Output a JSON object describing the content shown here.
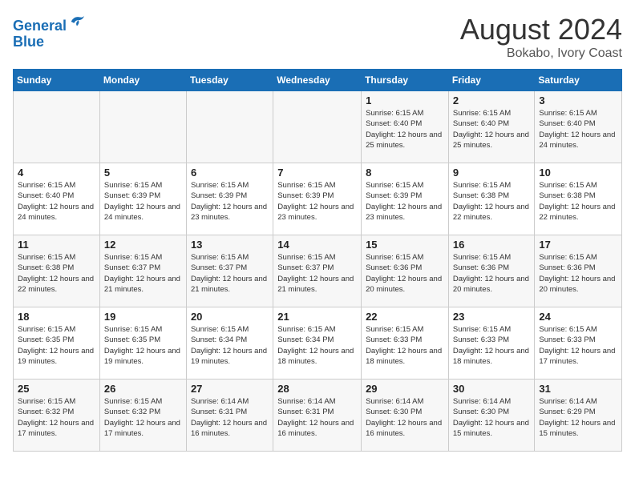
{
  "header": {
    "logo_line1": "General",
    "logo_line2": "Blue",
    "month_year": "August 2024",
    "location": "Bokabo, Ivory Coast"
  },
  "weekdays": [
    "Sunday",
    "Monday",
    "Tuesday",
    "Wednesday",
    "Thursday",
    "Friday",
    "Saturday"
  ],
  "weeks": [
    [
      {
        "day": "",
        "info": ""
      },
      {
        "day": "",
        "info": ""
      },
      {
        "day": "",
        "info": ""
      },
      {
        "day": "",
        "info": ""
      },
      {
        "day": "1",
        "info": "Sunrise: 6:15 AM\nSunset: 6:40 PM\nDaylight: 12 hours\nand 25 minutes."
      },
      {
        "day": "2",
        "info": "Sunrise: 6:15 AM\nSunset: 6:40 PM\nDaylight: 12 hours\nand 25 minutes."
      },
      {
        "day": "3",
        "info": "Sunrise: 6:15 AM\nSunset: 6:40 PM\nDaylight: 12 hours\nand 24 minutes."
      }
    ],
    [
      {
        "day": "4",
        "info": "Sunrise: 6:15 AM\nSunset: 6:40 PM\nDaylight: 12 hours\nand 24 minutes."
      },
      {
        "day": "5",
        "info": "Sunrise: 6:15 AM\nSunset: 6:39 PM\nDaylight: 12 hours\nand 24 minutes."
      },
      {
        "day": "6",
        "info": "Sunrise: 6:15 AM\nSunset: 6:39 PM\nDaylight: 12 hours\nand 23 minutes."
      },
      {
        "day": "7",
        "info": "Sunrise: 6:15 AM\nSunset: 6:39 PM\nDaylight: 12 hours\nand 23 minutes."
      },
      {
        "day": "8",
        "info": "Sunrise: 6:15 AM\nSunset: 6:39 PM\nDaylight: 12 hours\nand 23 minutes."
      },
      {
        "day": "9",
        "info": "Sunrise: 6:15 AM\nSunset: 6:38 PM\nDaylight: 12 hours\nand 22 minutes."
      },
      {
        "day": "10",
        "info": "Sunrise: 6:15 AM\nSunset: 6:38 PM\nDaylight: 12 hours\nand 22 minutes."
      }
    ],
    [
      {
        "day": "11",
        "info": "Sunrise: 6:15 AM\nSunset: 6:38 PM\nDaylight: 12 hours\nand 22 minutes."
      },
      {
        "day": "12",
        "info": "Sunrise: 6:15 AM\nSunset: 6:37 PM\nDaylight: 12 hours\nand 21 minutes."
      },
      {
        "day": "13",
        "info": "Sunrise: 6:15 AM\nSunset: 6:37 PM\nDaylight: 12 hours\nand 21 minutes."
      },
      {
        "day": "14",
        "info": "Sunrise: 6:15 AM\nSunset: 6:37 PM\nDaylight: 12 hours\nand 21 minutes."
      },
      {
        "day": "15",
        "info": "Sunrise: 6:15 AM\nSunset: 6:36 PM\nDaylight: 12 hours\nand 20 minutes."
      },
      {
        "day": "16",
        "info": "Sunrise: 6:15 AM\nSunset: 6:36 PM\nDaylight: 12 hours\nand 20 minutes."
      },
      {
        "day": "17",
        "info": "Sunrise: 6:15 AM\nSunset: 6:36 PM\nDaylight: 12 hours\nand 20 minutes."
      }
    ],
    [
      {
        "day": "18",
        "info": "Sunrise: 6:15 AM\nSunset: 6:35 PM\nDaylight: 12 hours\nand 19 minutes."
      },
      {
        "day": "19",
        "info": "Sunrise: 6:15 AM\nSunset: 6:35 PM\nDaylight: 12 hours\nand 19 minutes."
      },
      {
        "day": "20",
        "info": "Sunrise: 6:15 AM\nSunset: 6:34 PM\nDaylight: 12 hours\nand 19 minutes."
      },
      {
        "day": "21",
        "info": "Sunrise: 6:15 AM\nSunset: 6:34 PM\nDaylight: 12 hours\nand 18 minutes."
      },
      {
        "day": "22",
        "info": "Sunrise: 6:15 AM\nSunset: 6:33 PM\nDaylight: 12 hours\nand 18 minutes."
      },
      {
        "day": "23",
        "info": "Sunrise: 6:15 AM\nSunset: 6:33 PM\nDaylight: 12 hours\nand 18 minutes."
      },
      {
        "day": "24",
        "info": "Sunrise: 6:15 AM\nSunset: 6:33 PM\nDaylight: 12 hours\nand 17 minutes."
      }
    ],
    [
      {
        "day": "25",
        "info": "Sunrise: 6:15 AM\nSunset: 6:32 PM\nDaylight: 12 hours\nand 17 minutes."
      },
      {
        "day": "26",
        "info": "Sunrise: 6:15 AM\nSunset: 6:32 PM\nDaylight: 12 hours\nand 17 minutes."
      },
      {
        "day": "27",
        "info": "Sunrise: 6:14 AM\nSunset: 6:31 PM\nDaylight: 12 hours\nand 16 minutes."
      },
      {
        "day": "28",
        "info": "Sunrise: 6:14 AM\nSunset: 6:31 PM\nDaylight: 12 hours\nand 16 minutes."
      },
      {
        "day": "29",
        "info": "Sunrise: 6:14 AM\nSunset: 6:30 PM\nDaylight: 12 hours\nand 16 minutes."
      },
      {
        "day": "30",
        "info": "Sunrise: 6:14 AM\nSunset: 6:30 PM\nDaylight: 12 hours\nand 15 minutes."
      },
      {
        "day": "31",
        "info": "Sunrise: 6:14 AM\nSunset: 6:29 PM\nDaylight: 12 hours\nand 15 minutes."
      }
    ]
  ]
}
